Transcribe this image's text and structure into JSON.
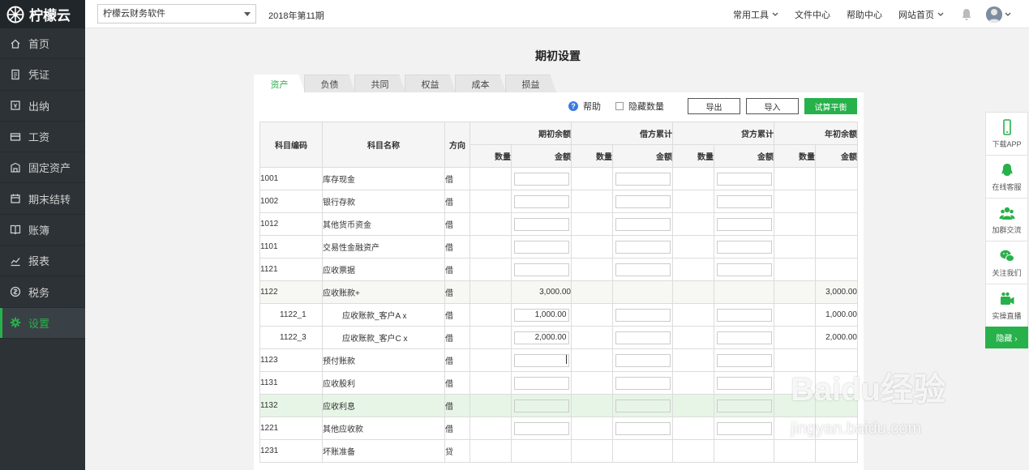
{
  "app": {
    "logo_text": "柠檬云"
  },
  "sidebar": {
    "items": [
      {
        "label": "首页",
        "icon": "home-icon"
      },
      {
        "label": "凭证",
        "icon": "voucher-icon"
      },
      {
        "label": "出纳",
        "icon": "cashier-icon"
      },
      {
        "label": "工资",
        "icon": "salary-icon"
      },
      {
        "label": "固定资产",
        "icon": "asset-icon"
      },
      {
        "label": "期末结转",
        "icon": "calendar-icon"
      },
      {
        "label": "账簿",
        "icon": "ledger-icon"
      },
      {
        "label": "报表",
        "icon": "chart-icon"
      },
      {
        "label": "税务",
        "icon": "tax-icon"
      },
      {
        "label": "设置",
        "icon": "gear-icon",
        "active": true
      }
    ]
  },
  "header": {
    "company": "柠檬云财务软件",
    "period": "2018年第11期",
    "links": [
      "常用工具",
      "文件中心",
      "帮助中心",
      "网站首页"
    ]
  },
  "page": {
    "title": "期初设置",
    "tabs": [
      "资产",
      "负债",
      "共同",
      "权益",
      "成本",
      "损益"
    ],
    "active_tab": 0
  },
  "toolbar": {
    "help": "帮助",
    "hide_qty": "隐藏数量",
    "export": "导出",
    "import": "导入",
    "trial_balance": "试算平衡"
  },
  "table": {
    "headers": {
      "code": "科目编码",
      "name": "科目名称",
      "direction": "方向",
      "opening": "期初余额",
      "debit": "借方累计",
      "credit": "贷方累计",
      "year_open": "年初余额",
      "qty": "数量",
      "amount": "金额"
    },
    "rows": [
      {
        "code": "1001",
        "name": "库存现金",
        "dir": "借",
        "opening": "",
        "year_open": "",
        "editable": true,
        "style": ""
      },
      {
        "code": "1002",
        "name": "银行存款",
        "dir": "借",
        "opening": "",
        "year_open": "",
        "editable": true,
        "style": ""
      },
      {
        "code": "1012",
        "name": "其他货币资金",
        "dir": "借",
        "opening": "",
        "year_open": "",
        "editable": true,
        "style": ""
      },
      {
        "code": "1101",
        "name": "交易性金融资产",
        "dir": "借",
        "opening": "",
        "year_open": "",
        "editable": true,
        "style": ""
      },
      {
        "code": "1121",
        "name": "应收票据",
        "dir": "借",
        "opening": "",
        "year_open": "",
        "editable": true,
        "style": ""
      },
      {
        "code": "1122",
        "name": "应收账款+",
        "dir": "借",
        "opening": "3,000.00",
        "year_open": "3,000.00",
        "editable": false,
        "style": "hl"
      },
      {
        "code": "1122_1",
        "name": "应收账款_客户A   x",
        "dir": "借",
        "opening": "1,000.00",
        "year_open": "1,000.00",
        "editable": true,
        "style": "sub"
      },
      {
        "code": "1122_3",
        "name": "应收账款_客户C   x",
        "dir": "借",
        "opening": "2,000.00",
        "year_open": "2,000.00",
        "editable": true,
        "style": "sub"
      },
      {
        "code": "1123",
        "name": "预付账款",
        "dir": "借",
        "opening": "",
        "year_open": "",
        "editable": true,
        "style": "cursor"
      },
      {
        "code": "1131",
        "name": "应收股利",
        "dir": "借",
        "opening": "",
        "year_open": "",
        "editable": true,
        "style": ""
      },
      {
        "code": "1132",
        "name": "应收利息",
        "dir": "借",
        "opening": "",
        "year_open": "",
        "editable": true,
        "style": "green"
      },
      {
        "code": "1221",
        "name": "其他应收款",
        "dir": "借",
        "opening": "",
        "year_open": "",
        "editable": true,
        "style": ""
      },
      {
        "code": "1231",
        "name": "坏账准备",
        "dir": "贷",
        "opening": "",
        "year_open": "",
        "editable": false,
        "style": ""
      }
    ]
  },
  "float": {
    "items": [
      {
        "label": "下载APP",
        "icon": "phone-icon"
      },
      {
        "label": "在线客服",
        "icon": "qq-icon"
      },
      {
        "label": "加群交流",
        "icon": "group-icon"
      },
      {
        "label": "关注我们",
        "icon": "wechat-icon"
      },
      {
        "label": "实操直播",
        "icon": "video-icon"
      }
    ],
    "hide": "隐藏 ›"
  },
  "watermark": {
    "line1": "Baidu经验",
    "line2": "jingyan.baidu.com"
  },
  "colors": {
    "accent": "#27b14a",
    "sidebar": "#2c3236"
  }
}
